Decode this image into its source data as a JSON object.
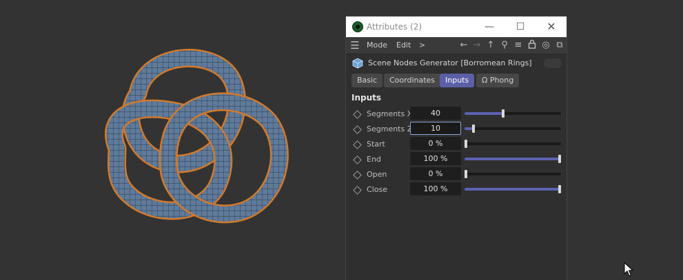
{
  "window": {
    "title": "Attributes (2)",
    "controls": [
      "minimize-icon",
      "maximize-icon",
      "close-icon"
    ]
  },
  "menubar": {
    "menu_icon": "hamburger-icon",
    "mode_label": "Mode",
    "edit_label": "Edit",
    "more_label": ">",
    "tools": [
      "arrow-left-icon",
      "arrow-right-icon",
      "arrow-up-icon",
      "search-icon",
      "filter-icon",
      "lock-icon",
      "target-icon",
      "external-link-icon"
    ]
  },
  "object": {
    "icon": "cube-icon",
    "name": "Scene Nodes Generator [Borromean Rings]"
  },
  "tabs": [
    {
      "label": "Basic",
      "active": false
    },
    {
      "label": "Coordinates",
      "active": false
    },
    {
      "label": "Inputs",
      "active": true
    },
    {
      "label": "Ω Phong",
      "active": false
    }
  ],
  "section": {
    "title": "Inputs"
  },
  "params": [
    {
      "label": "Segments X",
      "value": "40",
      "slider_fraction": 0.4,
      "focused": false
    },
    {
      "label": "Segments Z",
      "value": "10",
      "slider_fraction": 0.09,
      "focused": true
    },
    {
      "label": "Start",
      "value": "0 %",
      "slider_fraction": 0.0,
      "focused": false
    },
    {
      "label": "End",
      "value": "100 %",
      "slider_fraction": 1.0,
      "focused": false
    },
    {
      "label": "Open",
      "value": "0 %",
      "slider_fraction": 0.0,
      "focused": false
    },
    {
      "label": "Close",
      "value": "100 %",
      "slider_fraction": 1.0,
      "focused": false
    }
  ],
  "colors": {
    "accent": "#5b5fa6",
    "slider_fill": "#5c62b0",
    "knot_body": "#5d7898",
    "knot_outline": "#d27a2c",
    "viewport_bg": "#333333"
  }
}
